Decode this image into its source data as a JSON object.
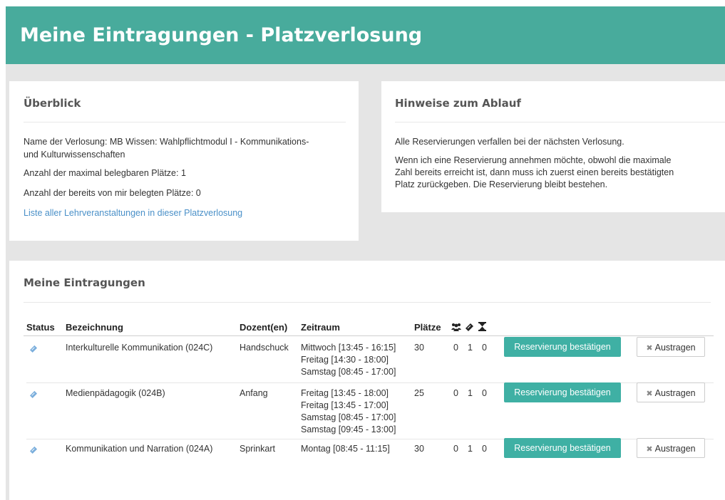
{
  "header": {
    "title": "Meine Eintragungen - Platzverlosung"
  },
  "overview": {
    "title": "Überblick",
    "name_line1": "Name der Verlosung: MB Wissen: Wahlpflichtmodul I - Kommunikations-",
    "name_line2": "und Kulturwissenschaften",
    "max_places": "Anzahl der maximal belegbaren Plätze: 1",
    "taken_places": "Anzahl der bereits von mir belegten Plätze: 0",
    "list_link": "Liste aller Lehrveranstaltungen in dieser Platzverlosung"
  },
  "hints": {
    "title": "Hinweise zum Ablauf",
    "p1": "Alle Reservierungen verfallen bei der nächsten Verlosung.",
    "p2_line1": "Wenn ich eine Reservierung annehmen möchte, obwohl die maximale",
    "p2_line2": "Zahl bereits erreicht ist, dann muss ich zuerst einen bereits bestätigten",
    "p2_line3": "Platz zurückgeben. Die Reservierung bleibt bestehen."
  },
  "entries": {
    "title": "Meine Eintragungen",
    "columns": {
      "status": "Status",
      "name": "Bezeichnung",
      "lecturer": "Dozent(en)",
      "period": "Zeitraum",
      "places": "Plätze"
    },
    "icons": {
      "participants": "group-icon",
      "reserved": "ticket-icon",
      "waiting": "hourglass-icon",
      "status": "ticket-icon",
      "remove": "close-icon"
    },
    "confirm_label": "Reservierung bestätigen",
    "remove_label": "Austragen",
    "rows": [
      {
        "name": "Interkulturelle Kommunikation (024C)",
        "lecturer": "Handschuck",
        "times": [
          "Mittwoch [13:45 - 16:15]",
          "Freitag [14:30 - 18:00]",
          "Samstag [08:45 - 17:00]"
        ],
        "places": "30",
        "participants": "0",
        "reserved": "1",
        "waiting": "0"
      },
      {
        "name": "Medienpädagogik (024B)",
        "lecturer": "Anfang",
        "times": [
          "Freitag [13:45 - 18:00]",
          "Freitag [13:45 - 17:00]",
          "Samstag [08:45 - 17:00]",
          "Samstag [09:45 - 13:00]"
        ],
        "places": "25",
        "participants": "0",
        "reserved": "1",
        "waiting": "0"
      },
      {
        "name": "Kommunikation und Narration (024A)",
        "lecturer": "Sprinkart",
        "times": [
          "Montag [08:45 - 11:15]"
        ],
        "places": "30",
        "participants": "0",
        "reserved": "1",
        "waiting": "0"
      }
    ]
  }
}
